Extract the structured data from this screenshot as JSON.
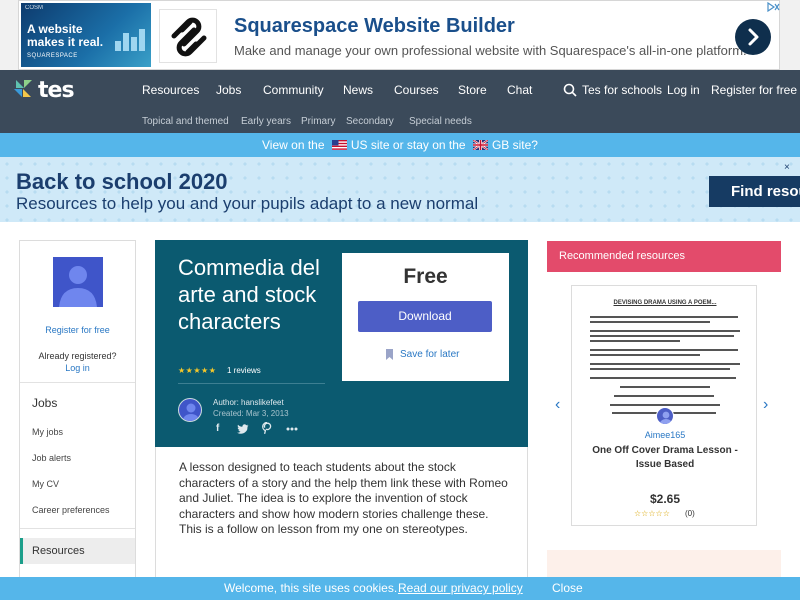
{
  "ad": {
    "image_headline": "A website makes it real.",
    "image_brand": "SQUARESPACE",
    "image_corner": "COSM",
    "title": "Squarespace Website Builder",
    "subtitle": "Make and manage your own professional website with Squarespace's all-in-one platform.",
    "go_icon": "chevron-right-icon",
    "info_icon": "adchoices-icon"
  },
  "nav": {
    "logo": "tes",
    "items": [
      "Resources",
      "Jobs",
      "Community",
      "News",
      "Courses",
      "Store",
      "Chat"
    ],
    "right": [
      "Tes for schools",
      "Log in",
      "Register for free"
    ],
    "sub_items": [
      "Topical and themed",
      "Early years",
      "Primary",
      "Secondary",
      "Special needs"
    ]
  },
  "switch_bar": {
    "lead": "View on the",
    "us_label": "US site",
    "mid": "or stay on the",
    "gb_label": "GB site?"
  },
  "promo": {
    "title": "Back to school 2020",
    "subtitle": "Resources to help you and your pupils adapt to a new normal",
    "button": "Find resources",
    "close": "×"
  },
  "sidebar": {
    "register": "Register for free",
    "already": "Already registered?",
    "login": "Log in",
    "jobs_title": "Jobs",
    "job_items": [
      "My jobs",
      "Job alerts",
      "My CV",
      "Career preferences"
    ],
    "active_item": "Resources"
  },
  "resource": {
    "title": "Commedia del arte and stock characters",
    "stars": "★★★★★",
    "reviews": "1 reviews",
    "author_label": "Author: hanslikefeet",
    "created": "Created: Mar 3, 2013",
    "price": "Free",
    "download": "Download",
    "save": "Save for later",
    "description": "A lesson designed to teach students about the stock characters of a story and the help them link these with Romeo and Juliet. The idea is to explore the invention of stock characters and show how modern stories challenge these. This is a follow on lesson from my one on stereotypes."
  },
  "recommended": {
    "header": "Recommended resources",
    "doc_title": "DEVISING DRAMA USING A POEM...",
    "author": "Aimee165",
    "title": "One Off Cover Drama Lesson - Issue Based",
    "price": "$2.65",
    "stars": "☆☆☆☆☆",
    "count": "(0)",
    "prev": "‹",
    "next": "›"
  },
  "cookie": {
    "message": "Welcome, this site uses cookies.",
    "link": "Read our privacy policy",
    "close": "Close"
  },
  "colors": {
    "nav_bg": "#3b4a5a",
    "accent_blue": "#55b6ea",
    "hero_teal": "#0b5a70",
    "download_btn": "#4d5ec6",
    "rec_header": "#e34b6b"
  }
}
